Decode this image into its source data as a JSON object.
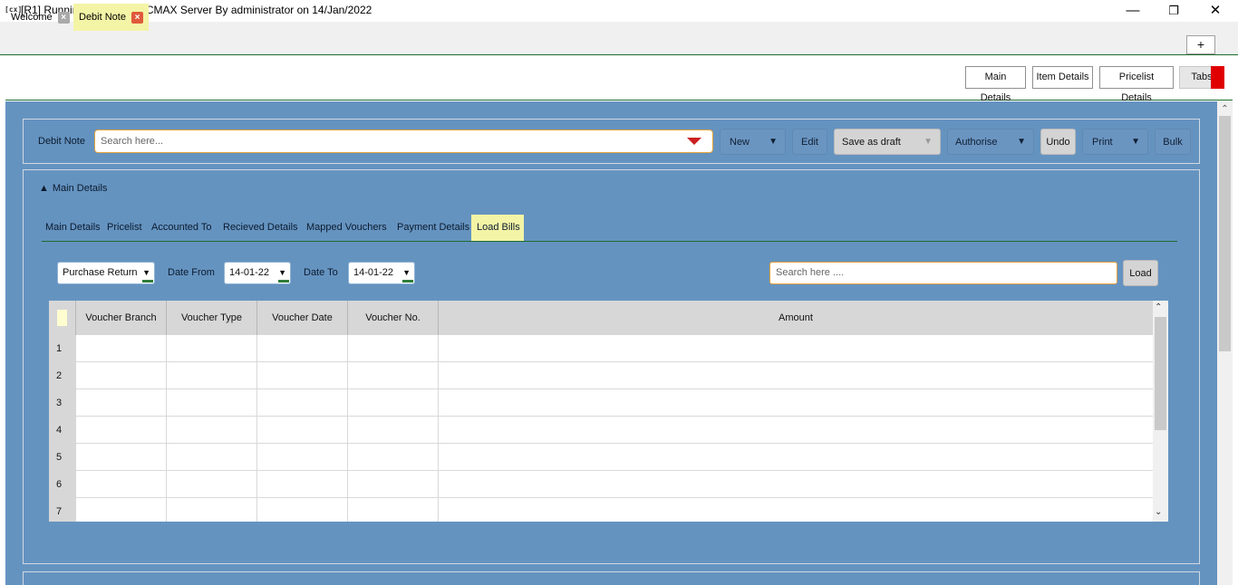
{
  "window": {
    "icon": "[cx]",
    "title": "[R1] Running ERP 5.1 on CMAX Server By administrator on 14/Jan/2022",
    "minimize_glyph": "—",
    "restore_glyph": "❐",
    "close_glyph": "✕"
  },
  "tabs": [
    {
      "label": "Welcome",
      "close_color": "#a9a9a9"
    },
    {
      "label": "Debit Note",
      "close_color": "#e05a3c"
    }
  ],
  "add_tab_label": "+",
  "top_buttons": [
    "Main Details",
    "Item Details",
    "Pricelist Details",
    "Tabs"
  ],
  "toolbar": {
    "label": "Debit Note",
    "search_placeholder": "Search here...",
    "new": "New",
    "edit": "Edit",
    "save_as_draft": "Save as draft",
    "authorise": "Authorise",
    "undo": "Undo",
    "print": "Print",
    "bulk": "Bulk"
  },
  "section": {
    "toggle": "▲",
    "title": "Main Details"
  },
  "subtabs": [
    "Main Details",
    "Pricelist",
    "Accounted To",
    "Recieved Details",
    "Mapped Vouchers",
    "Payment Details",
    "Load Bills"
  ],
  "active_subtab": "Load Bills",
  "filters": {
    "type_value": "Purchase Return",
    "date_from_label": "Date From",
    "date_from_value": "14-01-22",
    "date_to_label": "Date To",
    "date_to_value": "14-01-22",
    "search_placeholder": "Search here ....",
    "load": "Load"
  },
  "grid": {
    "columns": [
      "Voucher Branch",
      "Voucher Type",
      "Voucher Date",
      "Voucher No.",
      "Amount"
    ],
    "row_numbers": [
      "1",
      "2",
      "3",
      "4",
      "5",
      "6",
      "7"
    ]
  },
  "colors": {
    "panel_blue": "#6593c0",
    "highlight_yellow": "#f4f4a6",
    "accent_green": "#1e6b2c",
    "accent_red": "#e00000"
  }
}
